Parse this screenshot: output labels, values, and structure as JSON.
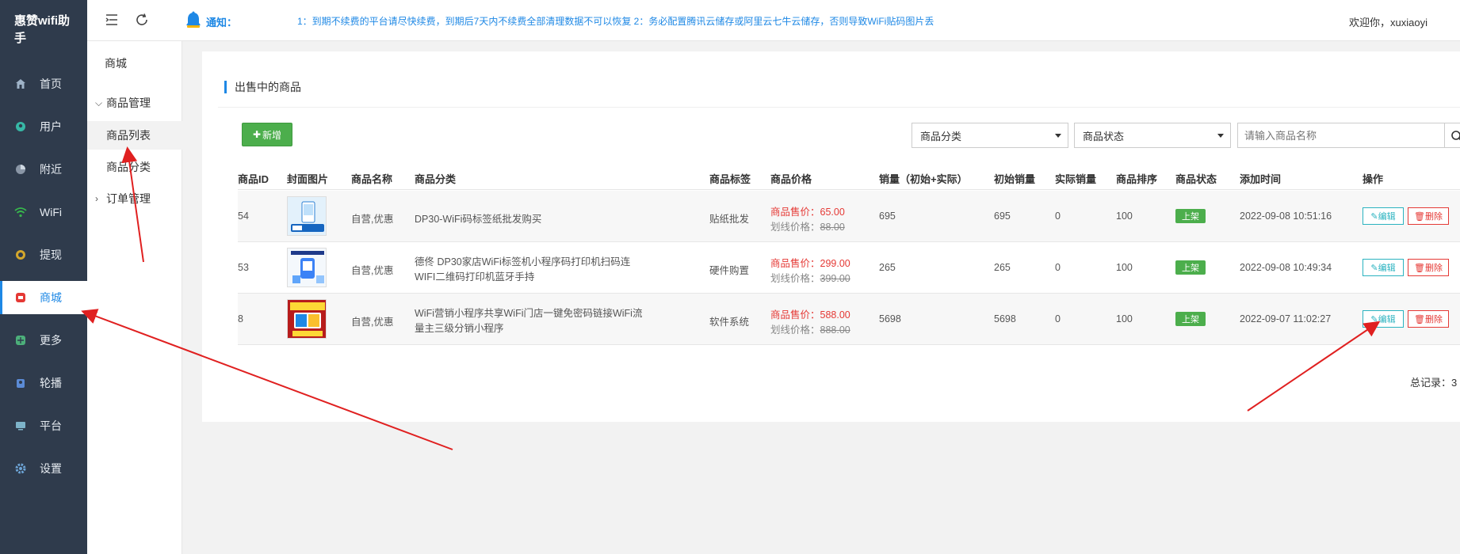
{
  "app": {
    "brand": "惠赞wifi助手"
  },
  "sidebar": {
    "items": [
      {
        "label": "首页",
        "icon": "home-icon"
      },
      {
        "label": "用户",
        "icon": "user-icon"
      },
      {
        "label": "附近",
        "icon": "location-icon"
      },
      {
        "label": "WiFi",
        "icon": "wifi-icon"
      },
      {
        "label": "提现",
        "icon": "coin-icon"
      },
      {
        "label": "商城",
        "icon": "shop-icon",
        "active": true
      },
      {
        "label": "更多",
        "icon": "grid-icon"
      },
      {
        "label": "轮播",
        "icon": "carousel-icon"
      },
      {
        "label": "平台",
        "icon": "monitor-icon"
      },
      {
        "label": "设置",
        "icon": "gear-icon"
      }
    ]
  },
  "submenu": {
    "title": "商城",
    "group1": "商品管理",
    "item_list": "商品列表",
    "item_category": "商品分类",
    "group2": "订单管理"
  },
  "header": {
    "notice_label": "通知：",
    "notice_text": "1：到期不续费的平台请尽快续费，到期后7天内不续费全部清理数据不可以恢复 2：务必配置腾讯云储存或阿里云七牛云储存，否则导致WiFi贴码图片丢",
    "welcome": "欢迎你，xuxiaoyi"
  },
  "main": {
    "title": "出售中的商品",
    "add_button": "新增",
    "filter_category": "商品分类",
    "filter_status": "商品状态",
    "search_placeholder": "请输入商品名称",
    "columns": [
      "商品ID",
      "封面图片",
      "商品名称",
      "商品分类",
      "商品标签",
      "商品价格",
      "销量（初始+实际）",
      "初始销量",
      "实际销量",
      "商品排序",
      "商品状态",
      "添加时间",
      "操作"
    ],
    "sale_price_label": "商品售价：",
    "strike_price_label": "划线价格：",
    "rows": [
      {
        "id": "54",
        "name": "自营,优惠",
        "category_line1": "DP30-WiFi码标签纸批发购买",
        "category_line2": "",
        "tag": "贴纸批发",
        "sale_price": "65.00",
        "strike_price": "88.00",
        "sales": "695",
        "initial_sales": "695",
        "actual_sales": "0",
        "sort": "100",
        "status": "上架",
        "added": "2022-09-08 10:51:16"
      },
      {
        "id": "53",
        "name": "自营,优惠",
        "category_line1": "德佟 DP30家店WiFi标签机小程序码打印机扫码连",
        "category_line2": "WIFI二维码打印机蓝牙手持",
        "tag": "硬件购置",
        "sale_price": "299.00",
        "strike_price": "399.00",
        "sales": "265",
        "initial_sales": "265",
        "actual_sales": "0",
        "sort": "100",
        "status": "上架",
        "added": "2022-09-08 10:49:34"
      },
      {
        "id": "8",
        "name": "自营,优惠",
        "category_line1": "WiFi营销小程序共享WiFi门店一键免密码链接WiFi流",
        "category_line2": "量主三级分销小程序",
        "tag": "软件系统",
        "sale_price": "588.00",
        "strike_price": "888.00",
        "sales": "5698",
        "initial_sales": "5698",
        "actual_sales": "0",
        "sort": "100",
        "status": "上架",
        "added": "2022-09-07 11:02:27"
      }
    ],
    "edit_label": "编辑",
    "delete_label": "删除",
    "total_label": "总记录：3"
  },
  "colors": {
    "sidebar_bg": "#2f3b4c",
    "accent": "#1e88e5",
    "success": "#4cae4c",
    "danger": "#e53935",
    "annotation": "#e02020"
  }
}
